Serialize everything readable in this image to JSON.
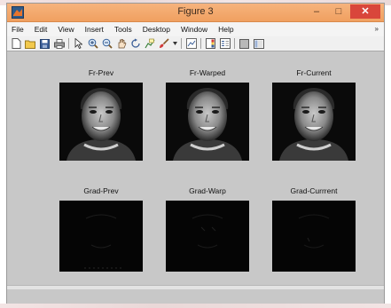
{
  "window": {
    "title": "Figure 3",
    "controls": {
      "minimize": "–",
      "maximize": "□",
      "close": "✕"
    }
  },
  "menubar": {
    "items": [
      "File",
      "Edit",
      "View",
      "Insert",
      "Tools",
      "Desktop",
      "Window",
      "Help"
    ],
    "overflow_arrow": "»"
  },
  "toolbar": {
    "buttons": [
      "new-figure-icon",
      "open-file-icon",
      "save-icon",
      "print-icon",
      "pointer-icon",
      "zoom-in-icon",
      "zoom-out-icon",
      "pan-icon",
      "rotate-icon",
      "data-cursor-icon",
      "brush-icon",
      "dropdown-icon",
      "link-plot-icon",
      "colorbar-icon",
      "legend-icon",
      "hide-plot-tools-icon",
      "show-plot-tools-icon"
    ]
  },
  "figure": {
    "rows": [
      {
        "kind": "frame",
        "panels": [
          {
            "title": "Fr-Prev"
          },
          {
            "title": "Fr-Warped"
          },
          {
            "title": "Fr-Current"
          }
        ]
      },
      {
        "kind": "gradient",
        "panels": [
          {
            "title": "Grad-Prev"
          },
          {
            "title": "Grad-Warp"
          },
          {
            "title": "Grad-Currrent"
          }
        ]
      }
    ]
  },
  "colors": {
    "titlebar": "#f0a060",
    "figure_background": "#c8c8c8",
    "image_background": "#0a0a0a",
    "close_button": "#d9463b"
  }
}
